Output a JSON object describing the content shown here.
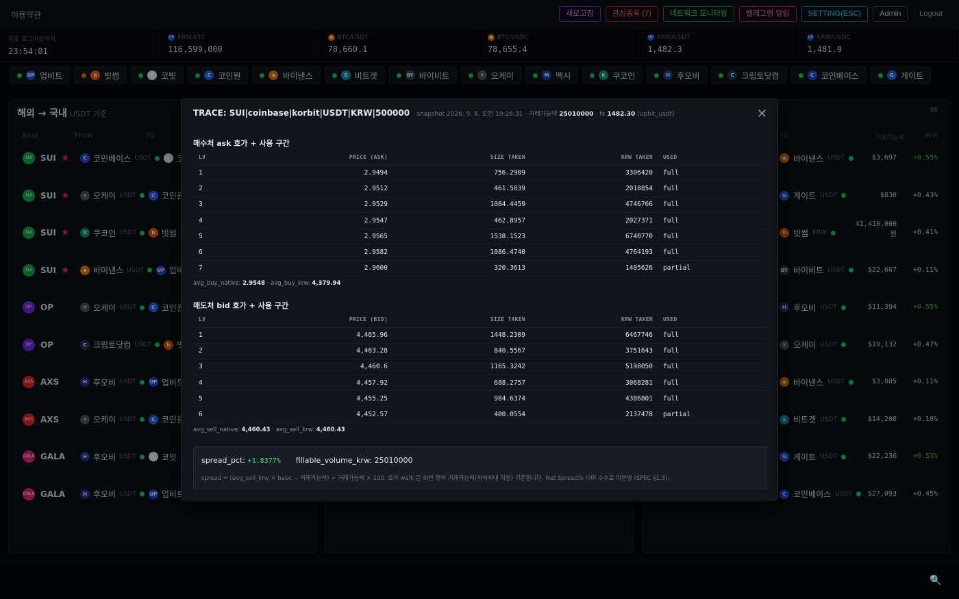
{
  "header": {
    "title": "이용약관",
    "buttons": [
      "새로고침",
      "관심종목 (7)",
      "네트워크 모니터링",
      "텔레그램 알림",
      "SETTING(ESC)",
      "Admin",
      "Logout"
    ]
  },
  "ticker": [
    {
      "label": "자동 로그아웃까지",
      "value": "23:54:01"
    },
    {
      "label": "KRW-BTC",
      "value": "116,599,000"
    },
    {
      "label": "BTC/USDT",
      "value": "78,660.1"
    },
    {
      "label": "BTC/USDC",
      "value": "78,655.4"
    },
    {
      "label": "KRW/USDT",
      "value": "1,482.3"
    },
    {
      "label": "KRW/USDC",
      "value": "1,481.9"
    }
  ],
  "exchanges": [
    {
      "name": "업비트",
      "icon": "UP",
      "color": "#1d4ed8"
    },
    {
      "name": "빗썸",
      "icon": "b",
      "color": "#ea580c",
      "status": "warn"
    },
    {
      "name": "코빗",
      "icon": "K",
      "color": "#e5e7eb"
    },
    {
      "name": "코인원",
      "icon": "C",
      "color": "#2563eb"
    },
    {
      "name": "바이낸스",
      "icon": "◆",
      "color": "#d97706"
    },
    {
      "name": "비트겟",
      "icon": "S",
      "color": "#0891b2"
    },
    {
      "name": "바이비트",
      "icon": "BY",
      "color": "#374151"
    },
    {
      "name": "오케이",
      "icon": "✕",
      "color": "#4b5563"
    },
    {
      "name": "멕시",
      "icon": "M",
      "color": "#1e40af"
    },
    {
      "name": "쿠코인",
      "icon": "K",
      "color": "#059669"
    },
    {
      "name": "후오비",
      "icon": "H",
      "color": "#1e3a8a"
    },
    {
      "name": "크립토닷컴",
      "icon": "C",
      "color": "#1e3a5f"
    },
    {
      "name": "코인베이스",
      "icon": "C",
      "color": "#1d4ed8"
    },
    {
      "name": "게이트",
      "icon": "G",
      "color": "#2563eb"
    }
  ],
  "left_panel": {
    "title": "해외 → 국내",
    "subtitle": "USDT 기준",
    "columns": [
      "BASE",
      "FROM",
      "TO"
    ],
    "rows": [
      {
        "coin": "SUI",
        "starred": true,
        "from": "코인베이스",
        "from_unit": "USDT",
        "to": "코빗"
      },
      {
        "coin": "SUI",
        "starred": true,
        "from": "오케이",
        "from_unit": "USDT",
        "to": "코인원"
      },
      {
        "coin": "SUI",
        "starred": true,
        "from": "쿠코인",
        "from_unit": "USDT",
        "to": "빗썸"
      },
      {
        "coin": "SUI",
        "starred": true,
        "from": "바이낸스",
        "from_unit": "USDT",
        "to": "업비트"
      },
      {
        "coin": "OP",
        "starred": false,
        "from": "오케이",
        "from_unit": "USDT",
        "to": "코인원"
      },
      {
        "coin": "OP",
        "starred": false,
        "from": "크립토닷컴",
        "from_unit": "USDT",
        "to": "빗썸"
      },
      {
        "coin": "AXS",
        "starred": false,
        "from": "후오비",
        "from_unit": "USDT",
        "to": "업비트"
      },
      {
        "coin": "AXS",
        "starred": false,
        "from": "오케이",
        "from_unit": "USDT",
        "to": "코인원"
      },
      {
        "coin": "GALA",
        "starred": false,
        "from": "후오비",
        "from_unit": "USDT",
        "to": "코빗"
      },
      {
        "coin": "GALA",
        "starred": false,
        "from": "후오비",
        "from_unit": "USDT",
        "to": "업비트"
      }
    ]
  },
  "right_panel": {
    "count": "88",
    "columns": [
      "TO",
      "거래가능액",
      "PER"
    ],
    "rows": [
      {
        "to": "바이낸스",
        "unit": "USDT",
        "volume": "$3,697",
        "per": "+0.55%",
        "per_green": true
      },
      {
        "to": "게이트",
        "unit": "USDT",
        "volume": "$830",
        "per": "+0.43%",
        "per_green": false
      },
      {
        "to": "빗썸",
        "unit": "KRW",
        "volume": "41,410,000",
        "volume_sub": "원",
        "per": "+0.41%",
        "per_green": false
      },
      {
        "to": "바이비트",
        "unit": "USDT",
        "volume": "$22,667",
        "per": "+0.11%",
        "per_green": false
      },
      {
        "to": "후오비",
        "unit": "USDT",
        "volume": "$11,394",
        "per": "+0.55%",
        "per_green": true
      },
      {
        "to": "오케이",
        "unit": "USDT",
        "volume": "$19,132",
        "per": "+0.47%",
        "per_green": false
      },
      {
        "to": "바이낸스",
        "unit": "USDT",
        "volume": "$3,805",
        "per": "+0.11%",
        "per_green": false
      },
      {
        "to": "비트겟",
        "unit": "USDT",
        "volume": "$14,208",
        "per": "+0.10%",
        "per_green": false
      },
      {
        "to": "게이트",
        "unit": "USDT",
        "volume": "$22,236",
        "per": "+0.53%",
        "per_green": true
      },
      {
        "to": "코인베이스",
        "unit": "USDT",
        "volume": "$27,093",
        "per": "+0.45%",
        "per_green": false
      }
    ]
  },
  "modal": {
    "title": "TRACE: SUI|coinbase|korbit|USDT|KRW|500000",
    "snapshot_prefix": "snapshot 2026. 9. 8. 오전 10:26:31 · 거래가능액",
    "snapshot_amount": "25010000",
    "fx_label": "· fx",
    "fx_value": "1482.30",
    "fx_source": "(upbit_usdt)",
    "close_icon": "close-icon",
    "ask_title": "매수처 ask 호가 + 사용 구간",
    "ask_columns": [
      "LV",
      "PRICE (ASK)",
      "SIZE TAKEN",
      "KRW TAKEN",
      "USED"
    ],
    "ask_rows": [
      [
        "1",
        "2.9494",
        "756.2909",
        "3306420",
        "full"
      ],
      [
        "2",
        "2.9512",
        "461.5039",
        "2018854",
        "full"
      ],
      [
        "3",
        "2.9529",
        "1084.4459",
        "4746766",
        "full"
      ],
      [
        "4",
        "2.9547",
        "462.8957",
        "2027371",
        "full"
      ],
      [
        "5",
        "2.9565",
        "1538.1523",
        "6740770",
        "full"
      ],
      [
        "6",
        "2.9582",
        "1086.4740",
        "4764193",
        "full"
      ],
      [
        "7",
        "2.9600",
        "320.3613",
        "1405626",
        "partial"
      ]
    ],
    "ask_avg": {
      "l1": "avg_buy_native:",
      "v1": "2.9548",
      "sep": "·",
      "l2": "avg_buy_krw:",
      "v2": "4,379.94"
    },
    "bid_title": "매도처 bid 호가 + 사용 구간",
    "bid_columns": [
      "LV",
      "PRICE (BID)",
      "SIZE TAKEN",
      "KRW TAKEN",
      "USED"
    ],
    "bid_rows": [
      [
        "1",
        "4,465.96",
        "1448.2309",
        "6467746",
        "full"
      ],
      [
        "2",
        "4,463.28",
        "840.5567",
        "3751643",
        "full"
      ],
      [
        "3",
        "4,460.6",
        "1165.3242",
        "5198050",
        "full"
      ],
      [
        "4",
        "4,457.92",
        "688.2757",
        "3068281",
        "full"
      ],
      [
        "5",
        "4,455.25",
        "984.6374",
        "4386801",
        "full"
      ],
      [
        "6",
        "4,452.57",
        "480.0554",
        "2137478",
        "partial"
      ]
    ],
    "bid_avg": {
      "l1": "avg_sell_native:",
      "v1": "4,460.43",
      "sep": "·",
      "l2": "avg_sell_krw:",
      "v2": "4,460.43"
    },
    "spread_label": "spread_pct:",
    "spread_value": "+1.8377%",
    "fillable_label": "fillable_volume_krw:",
    "fillable_value": "25010000",
    "note": "spread = (avg_sell_krw × base − 거래가능액) ÷ 거래가능액 × 100. 호가 walk 은 화면 행의 거래가능액(차익최대 지점) 기준입니다. Net Spread% 이며 수수료 미반영 (SPEC §1.3)."
  },
  "colors": {
    "accent_green": "#22c55e",
    "partial": "#f59e0b",
    "star": "#db2777"
  }
}
